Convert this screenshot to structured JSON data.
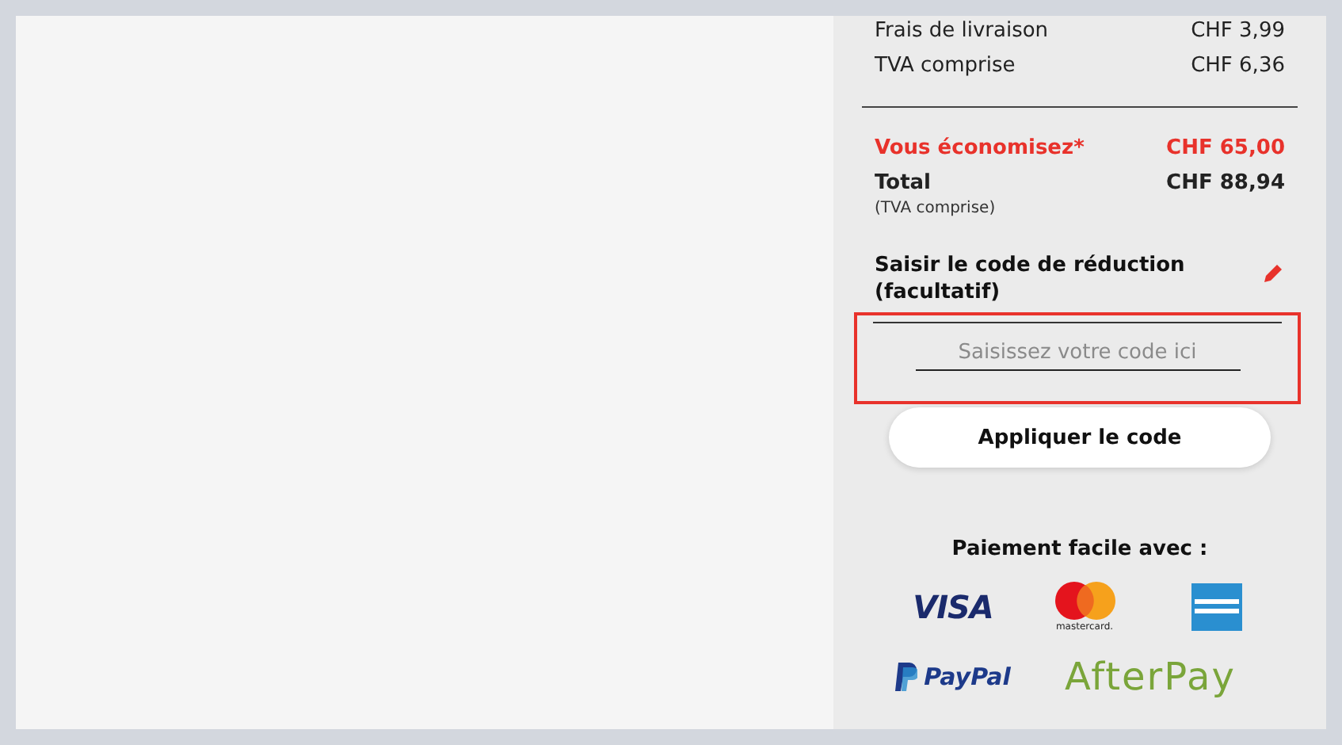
{
  "summary": {
    "lines": [
      {
        "label": "Frais de livraison",
        "value": "CHF 3,99"
      },
      {
        "label": "TVA comprise",
        "value": "CHF 6,36"
      }
    ],
    "savings": {
      "label": "Vous économisez*",
      "value": "CHF 65,00"
    },
    "total": {
      "label": "Total",
      "value": "CHF 88,94",
      "note": "(TVA comprise)"
    }
  },
  "discount": {
    "title": "Saisir le code de réduction (facultatif)",
    "placeholder": "Saisissez votre code ici",
    "highlighted": true,
    "button": "Appliquer le code"
  },
  "payment": {
    "title": "Paiement facile avec :",
    "methods": [
      {
        "kind": "visa",
        "label": "VISA"
      },
      {
        "kind": "mastercard",
        "label": "mastercard."
      },
      {
        "kind": "amex"
      },
      {
        "kind": "paypal",
        "label": "PayPal"
      },
      {
        "kind": "afterpay",
        "label": "AfterPay"
      }
    ]
  }
}
